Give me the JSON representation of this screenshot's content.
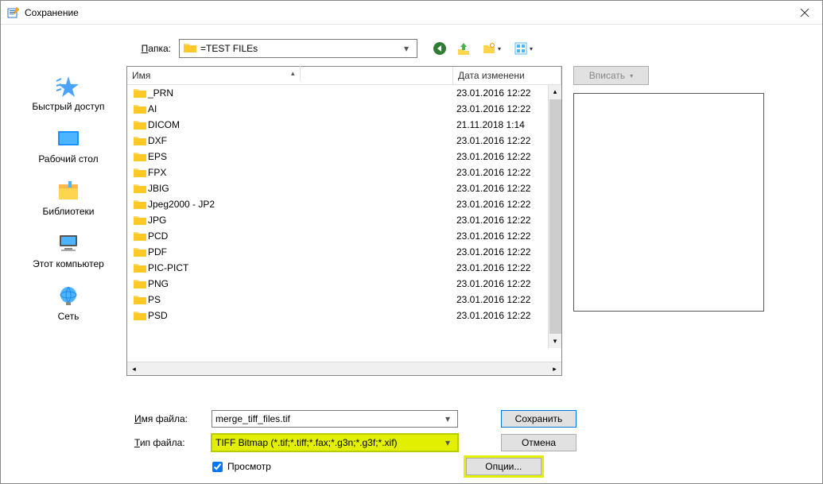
{
  "window": {
    "title": "Сохранение"
  },
  "toprow": {
    "folder_label": "Папка:",
    "folder_value": "=TEST FILEs"
  },
  "sidebar": {
    "items": [
      {
        "label": "Быстрый доступ"
      },
      {
        "label": "Рабочий стол"
      },
      {
        "label": "Библиотеки"
      },
      {
        "label": "Этот компьютер"
      },
      {
        "label": "Сеть"
      }
    ]
  },
  "columns": {
    "name": "Имя",
    "modified": "Дата изменени"
  },
  "files": [
    {
      "name": "_PRN",
      "date": "23.01.2016 12:22"
    },
    {
      "name": "AI",
      "date": "23.01.2016 12:22"
    },
    {
      "name": "DICOM",
      "date": "21.11.2018 1:14"
    },
    {
      "name": "DXF",
      "date": "23.01.2016 12:22"
    },
    {
      "name": "EPS",
      "date": "23.01.2016 12:22"
    },
    {
      "name": "FPX",
      "date": "23.01.2016 12:22"
    },
    {
      "name": "JBIG",
      "date": "23.01.2016 12:22"
    },
    {
      "name": "Jpeg2000 - JP2",
      "date": "23.01.2016 12:22"
    },
    {
      "name": "JPG",
      "date": "23.01.2016 12:22"
    },
    {
      "name": "PCD",
      "date": "23.01.2016 12:22"
    },
    {
      "name": "PDF",
      "date": "23.01.2016 12:22"
    },
    {
      "name": "PIC-PICT",
      "date": "23.01.2016 12:22"
    },
    {
      "name": "PNG",
      "date": "23.01.2016 12:22"
    },
    {
      "name": "PS",
      "date": "23.01.2016 12:22"
    },
    {
      "name": "PSD",
      "date": "23.01.2016 12:22"
    }
  ],
  "fit_button": "Вписать",
  "bottom": {
    "filename_label": "Имя файла:",
    "filename_value": "merge_tiff_files.tif",
    "filetype_label": "Тип файла:",
    "filetype_value": "TIFF Bitmap (*.tif;*.tiff;*.fax;*.g3n;*.g3f;*.xif)",
    "preview_label": "Просмотр",
    "save": "Сохранить",
    "cancel": "Отмена",
    "options": "Опции..."
  }
}
